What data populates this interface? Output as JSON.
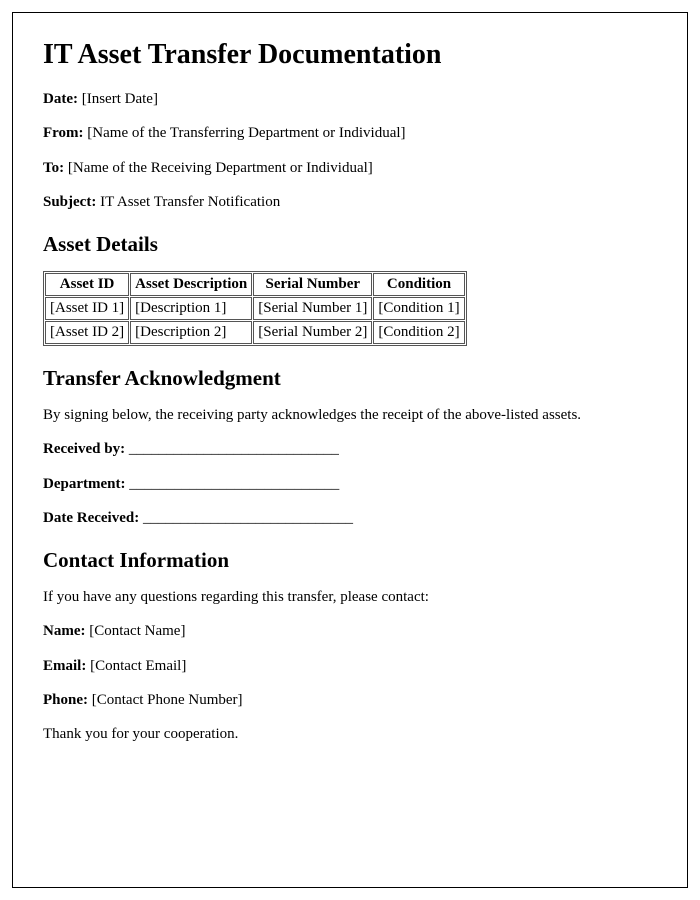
{
  "title": "IT Asset Transfer Documentation",
  "header": {
    "date_label": "Date:",
    "date_value": " [Insert Date]",
    "from_label": "From:",
    "from_value": " [Name of the Transferring Department or Individual]",
    "to_label": "To:",
    "to_value": " [Name of the Receiving Department or Individual]",
    "subject_label": "Subject:",
    "subject_value": " IT Asset Transfer Notification"
  },
  "asset_section": {
    "heading": "Asset Details",
    "columns": {
      "c0": "Asset ID",
      "c1": "Asset Description",
      "c2": "Serial Number",
      "c3": "Condition"
    },
    "rows": {
      "r0": {
        "c0": "[Asset ID 1]",
        "c1": "[Description 1]",
        "c2": "[Serial Number 1]",
        "c3": "[Condition 1]"
      },
      "r1": {
        "c0": "[Asset ID 2]",
        "c1": "[Description 2]",
        "c2": "[Serial Number 2]",
        "c3": "[Condition 2]"
      }
    }
  },
  "ack_section": {
    "heading": "Transfer Acknowledgment",
    "intro": "By signing below, the receiving party acknowledges the receipt of the above-listed assets.",
    "received_label": "Received by:",
    "received_line": " ____________________________",
    "dept_label": "Department:",
    "dept_line": " ____________________________",
    "date_label": "Date Received:",
    "date_line": " ____________________________"
  },
  "contact_section": {
    "heading": "Contact Information",
    "intro": "If you have any questions regarding this transfer, please contact:",
    "name_label": "Name:",
    "name_value": " [Contact Name]",
    "email_label": "Email:",
    "email_value": " [Contact Email]",
    "phone_label": "Phone:",
    "phone_value": " [Contact Phone Number]"
  },
  "closing": "Thank you for your cooperation."
}
